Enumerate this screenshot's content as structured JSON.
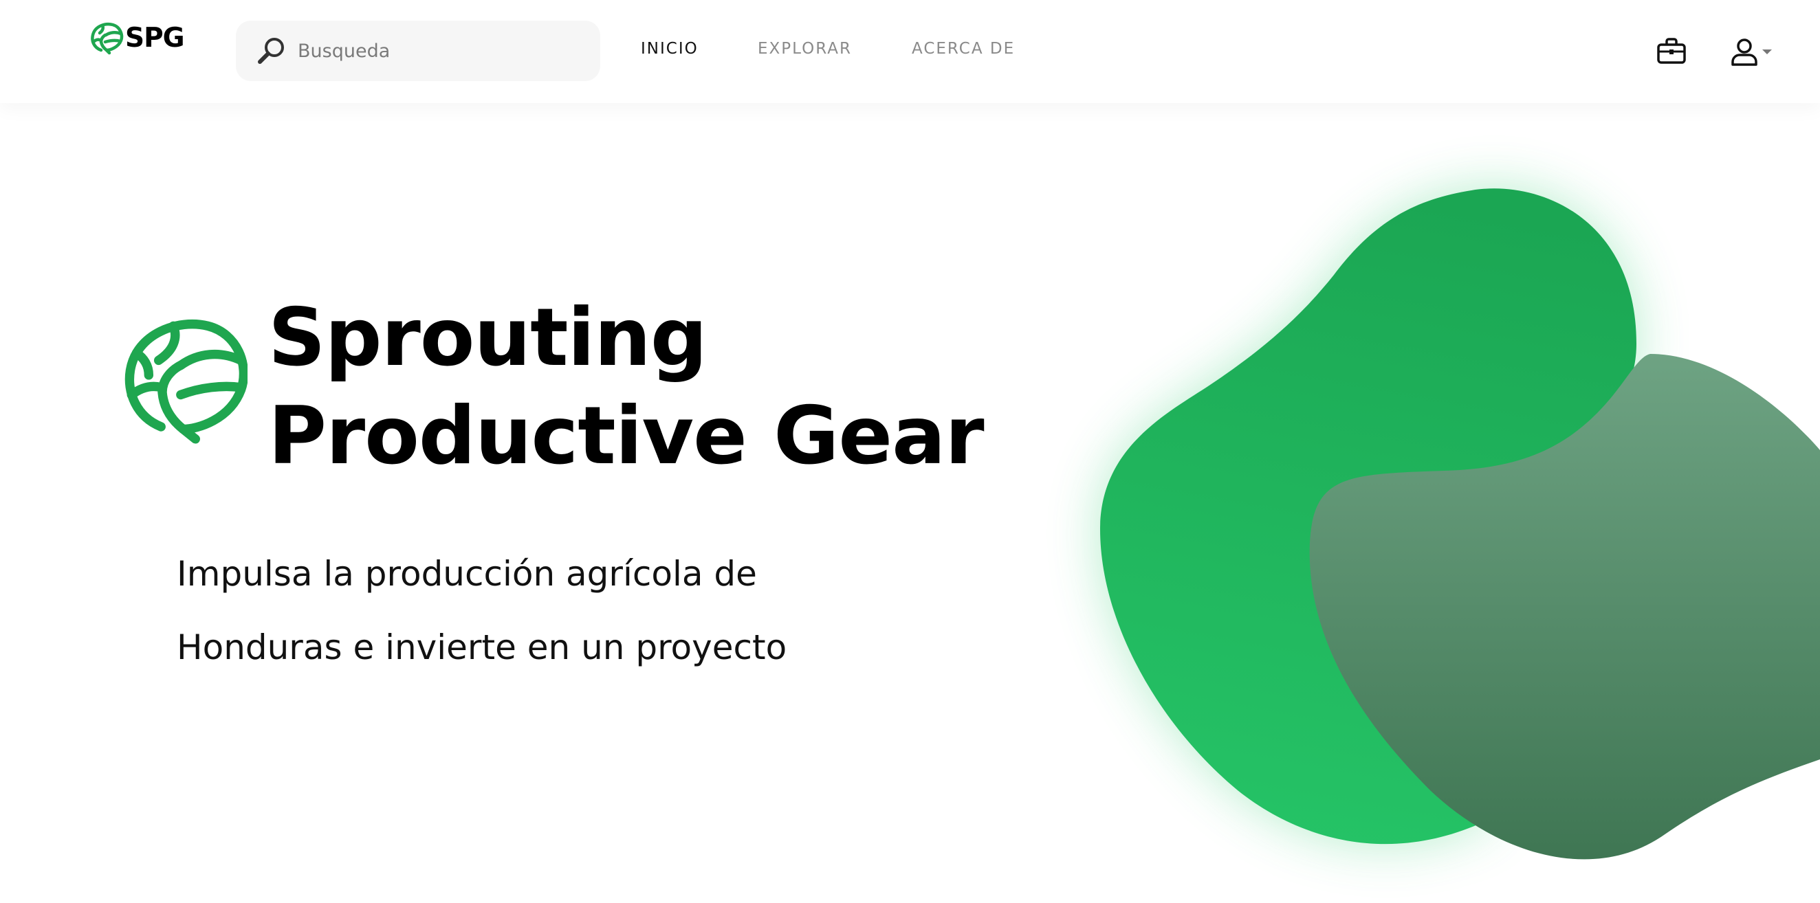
{
  "brand": {
    "name": "SPG",
    "color": "#1fa64f"
  },
  "search": {
    "placeholder": "Busqueda",
    "icon": "search-icon"
  },
  "nav": {
    "items": [
      {
        "label": "INICIO",
        "active": true
      },
      {
        "label": "EXPLORAR",
        "active": false
      },
      {
        "label": "ACERCA DE",
        "active": false
      }
    ]
  },
  "header_actions": {
    "cart_icon": "briefcase-icon",
    "user_icon": "user-icon"
  },
  "hero": {
    "title_line1": "Sprouting",
    "title_line2": "Productive Gear",
    "subtitle_line1": "Impulsa la producción agrícola de",
    "subtitle_line2": "Honduras e invierte en un proyecto",
    "logo_icon": "leaf-logo-icon"
  },
  "colors": {
    "accent_green": "#22c063",
    "dark_green_top": "#6aa07f",
    "dark_green_bottom": "#437a59",
    "text": "#000000",
    "nav_inactive": "#8a8a8a"
  }
}
